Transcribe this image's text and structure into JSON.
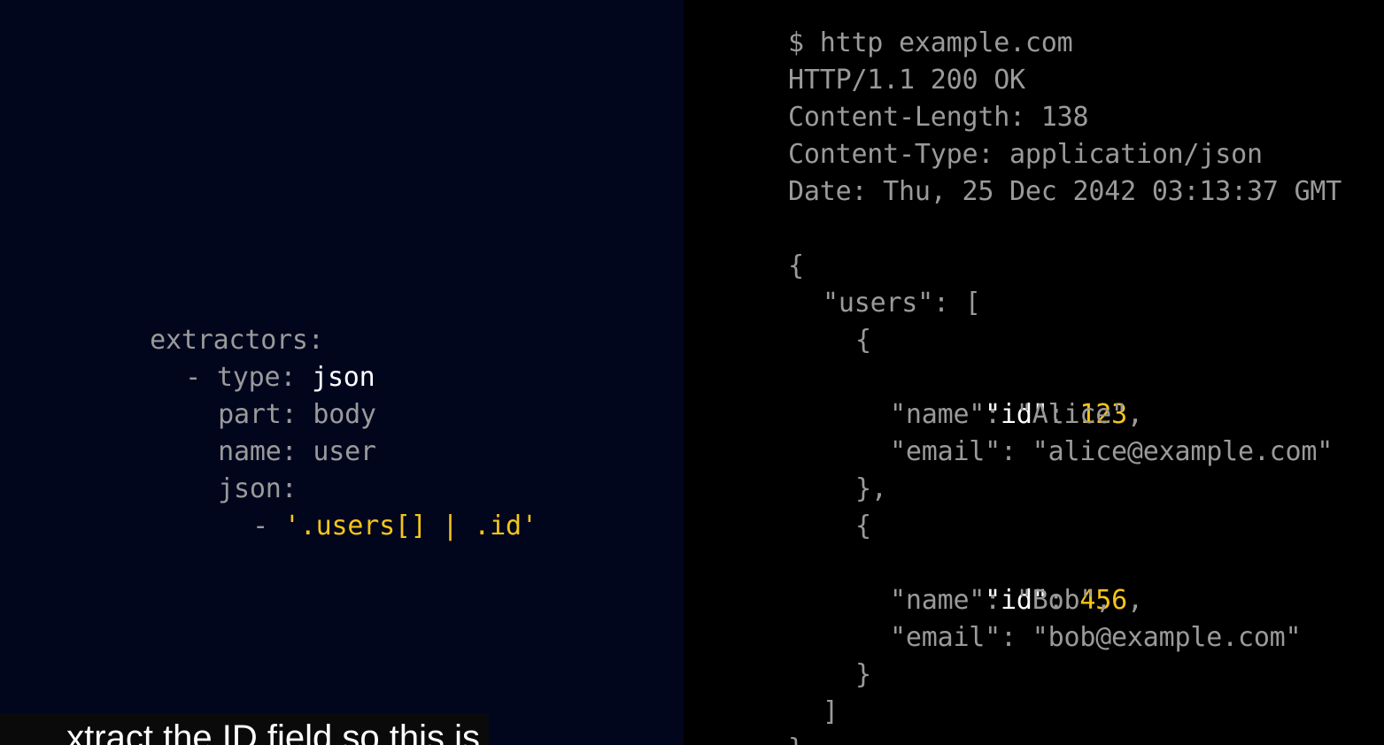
{
  "yaml": {
    "l1_key": "extractors:",
    "l2_dash": "- ",
    "l2_key": "type: ",
    "l2_val": "json",
    "l3": "part: body",
    "l4": "name: user",
    "l5": "json:",
    "l6_dash": "- ",
    "l6_val": "'.users[] | .id'"
  },
  "terminal": {
    "command": "$ http example.com",
    "status": "HTTP/1.1 200 OK",
    "content_length": "Content-Length: 138",
    "content_type": "Content-Type: application/json",
    "date": "Date: Thu, 25 Dec 2042 03:13:37 GMT",
    "open_brace": "{",
    "users_key": "\"users\": [",
    "obj1_open": "{",
    "obj1_id_key": "\"id\"",
    "colon_space": ": ",
    "obj1_id_val": "123",
    "comma": ",",
    "obj1_name": "\"name\": \"Alice\",",
    "obj1_email": "\"email\": \"alice@example.com\"",
    "obj1_close": "},",
    "obj2_open": "{",
    "obj2_id_key": "\"id\"",
    "obj2_id_val": "456",
    "obj2_name": "\"name\": \"Bob\",",
    "obj2_email": "\"email\": \"bob@example.com\"",
    "obj2_close": "}",
    "array_close": "]",
    "close_brace": "}"
  },
  "subtitle": {
    "text": "xtract the ID field so this is"
  },
  "colors": {
    "left_bg": "#01061d",
    "right_bg": "#000000",
    "dim_text": "#9a9a9a",
    "highlight": "#f5c518",
    "white": "#ffffff"
  }
}
